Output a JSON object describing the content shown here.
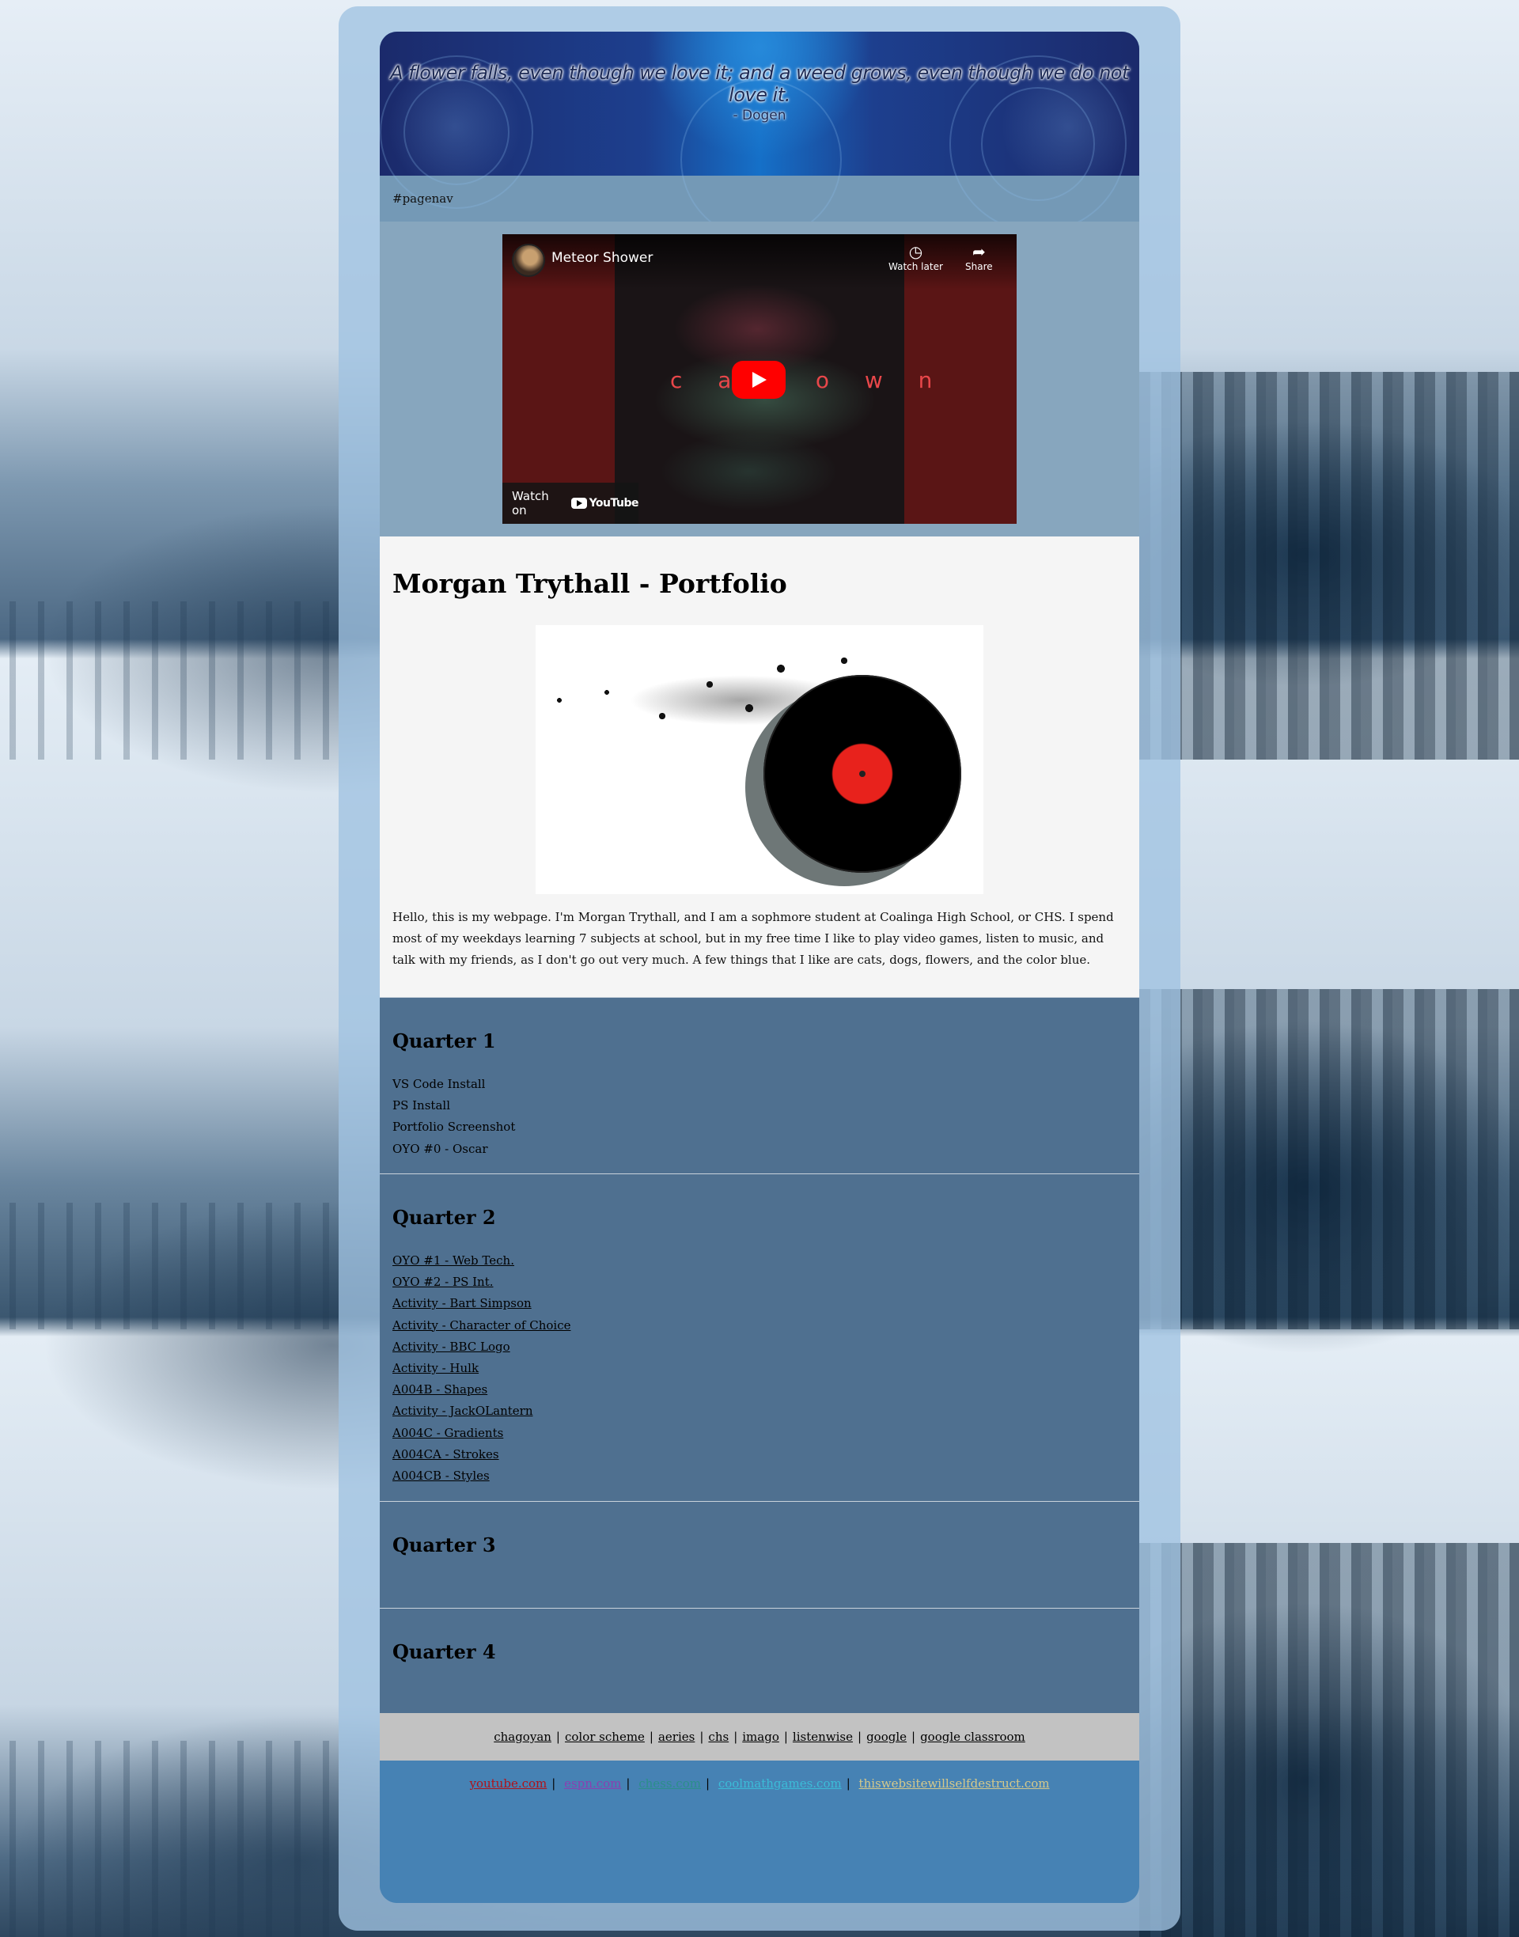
{
  "header": {
    "quote": "A flower falls, even though we love it; and a weed grows, even though we do not love it.",
    "author": "- Dogen"
  },
  "pagenav": {
    "label": "#pagenav"
  },
  "video": {
    "title": "Meteor Shower",
    "watch_later": "Watch later",
    "share": "Share",
    "overlay_text": "c a v         o w n",
    "watch_on": "Watch on",
    "youtube": "YouTube"
  },
  "intro": {
    "heading": "Morgan Trythall - Portfolio",
    "bio": "Hello, this is my webpage. I'm Morgan Trythall, and I am a sophmore student at Coalinga High School, or CHS. I spend most of my weekdays learning 7 subjects at school, but in my free time I like to play video games, listen to music, and talk with my friends, as I don't go out very much. A few things that I like are cats, dogs, flowers, and the color blue."
  },
  "quarters": [
    {
      "title": "Quarter 1",
      "items": [
        "VS Code Install",
        "PS Install",
        "Portfolio Screenshot",
        "OYO #0 - Oscar"
      ]
    },
    {
      "title": "Quarter 2",
      "items": [
        "OYO #1 - Web Tech.",
        "OYO #2 - PS Int.",
        "Activity - Bart Simpson",
        "Activity - Character of Choice",
        "Activity - BBC Logo",
        "Activity - Hulk",
        "A004B - Shapes",
        "Activity - JackOLantern",
        "A004C - Gradients",
        "A004CA - Strokes",
        "A004CB - Styles"
      ]
    },
    {
      "title": "Quarter 3",
      "items": []
    },
    {
      "title": "Quarter 4",
      "items": []
    }
  ],
  "footer_links": [
    "chagoyan",
    "color scheme",
    "aeries",
    "chs",
    "imago",
    "listenwise",
    "google",
    "google classroom"
  ],
  "external_links": [
    {
      "label": "youtube.com",
      "color": "#b0121a"
    },
    {
      "label": "espn.com",
      "color": "#8b3fb0"
    },
    {
      "label": "chess.com",
      "color": "#2b8f8a"
    },
    {
      "label": "coolmathgames.com",
      "color": "#3bbcd8"
    },
    {
      "label": "thiswebsitewillselfdestruct.com",
      "color": "#d6c98a"
    }
  ],
  "colors": {
    "pagenav_bg": "#7499b6",
    "quarter_bg": "#4f7090",
    "footer_bg": "#c2c2c2",
    "bottom_bg": "#4682b4"
  }
}
